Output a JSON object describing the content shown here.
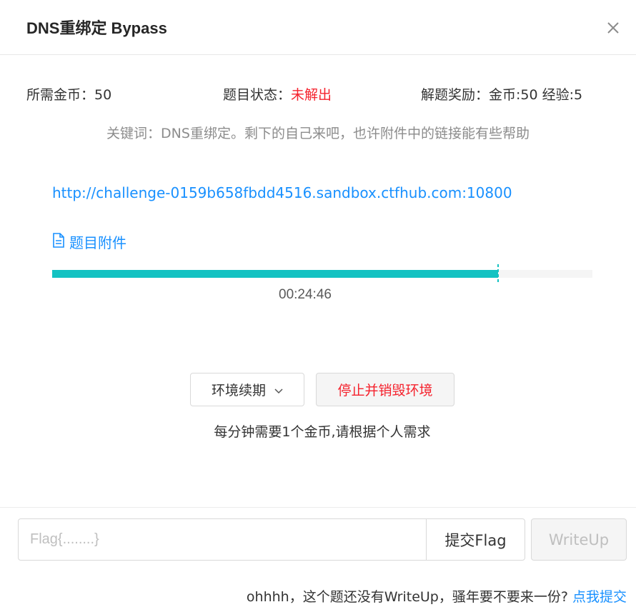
{
  "dialog": {
    "title": "DNS重绑定 Bypass"
  },
  "info": {
    "cost_label": "所需金币：",
    "cost_value": "50",
    "status_label": "题目状态：",
    "status_value": "未解出",
    "reward_label": "解题奖励：",
    "reward_value": "金币:50 经验:5"
  },
  "keywords": "关键词：DNS重绑定。剩下的自己来吧，也许附件中的链接能有些帮助",
  "challenge_url": "http://challenge-0159b658fbdd4516.sandbox.ctfhub.com:10800",
  "attachment_label": "题目附件",
  "progress": {
    "fraction": 0.826,
    "timer": "00:24:46"
  },
  "actions": {
    "renew_label": "环境续期",
    "stop_label": "停止并销毁环境",
    "hint": "每分钟需要1个金币,请根据个人需求"
  },
  "flag": {
    "placeholder": "Flag{........}",
    "value": "",
    "submit_label": "提交Flag",
    "writeup_label": "WriteUp"
  },
  "footer": {
    "text": "ohhhh，这个题还没有WriteUp，骚年要不要来一份?",
    "link": "点我提交"
  },
  "colors": {
    "accent": "#1890ff",
    "progress": "#13c2c2",
    "danger": "#f5222d"
  },
  "icons": [
    "close-icon",
    "file-icon",
    "chevron-down-icon"
  ]
}
